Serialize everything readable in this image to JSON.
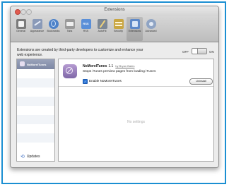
{
  "window": {
    "title": "Extensions"
  },
  "toolbar": {
    "items": [
      {
        "label": "General",
        "icon": "general-switch-icon",
        "color": "#7b7b7b"
      },
      {
        "label": "Appearance",
        "icon": "appearance-icon",
        "color": "#8a9ab8"
      },
      {
        "label": "Bookmarks",
        "icon": "bookmarks-globe-icon",
        "color": "#4d82c9"
      },
      {
        "label": "Tabs",
        "icon": "tabs-icon",
        "color": "#9a9a9a"
      },
      {
        "label": "RSS",
        "icon": "rss-icon",
        "color": "#5a8fd8"
      },
      {
        "label": "AutoFill",
        "icon": "autofill-pencil-icon",
        "color": "#7d8895"
      },
      {
        "label": "Security",
        "icon": "security-bars-icon",
        "color": "#c9a642"
      },
      {
        "label": "Extensions",
        "icon": "extensions-icon",
        "color": "#5e89c8"
      },
      {
        "label": "Advanced",
        "icon": "advanced-gear-icon",
        "color": "#8fa4c4"
      }
    ],
    "selected": "Extensions"
  },
  "header": {
    "description": "Extensions are created by third-party developers to customize and enhance your web experience.",
    "off_label": "OFF",
    "on_label": "ON",
    "toggle_state": "on"
  },
  "sidebar": {
    "selected_item": "NoMoreITunes",
    "updates_label": "Updates"
  },
  "extension": {
    "name": "NoMoreITunes",
    "version": "1.1",
    "developer_link": "by Bryan Bates",
    "description": "Stops iTunes preview pages from loading iTunes",
    "enable_label": "Enable NoMoreITunes",
    "enabled": true,
    "uninstall_label": "Uninstall",
    "no_settings": "No settings"
  },
  "colors": {
    "frame": "#1b8fd2",
    "accent": "#2c75d6",
    "extension_icon": "#9b82bf"
  }
}
